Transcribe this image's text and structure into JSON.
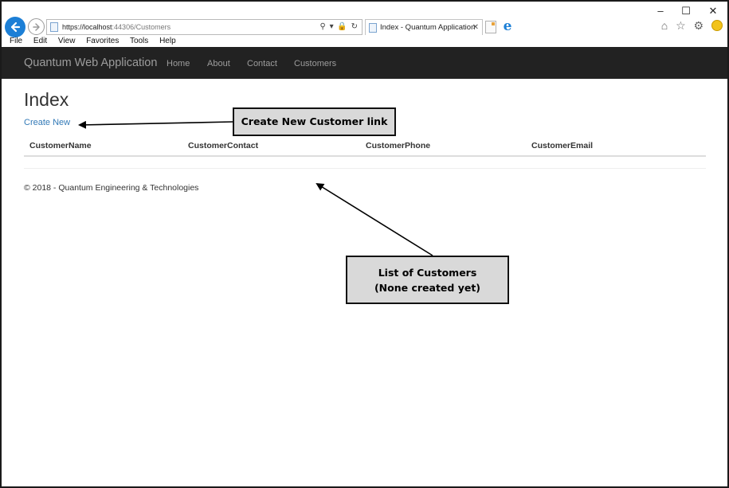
{
  "browser": {
    "url_host": "https://localhost",
    "url_rest": ":44306/Customers",
    "address_tools": "⚲ ▾ 🔒 ↻",
    "tab_title": "Index - Quantum Application",
    "tab_close": "✕",
    "window_controls": {
      "minimize": "–",
      "maximize": "☐",
      "close": "✕"
    },
    "right_icons": "⌂ ☆ ⚙",
    "menu": [
      "File",
      "Edit",
      "View",
      "Favorites",
      "Tools",
      "Help"
    ]
  },
  "navbar": {
    "brand": "Quantum Web Application",
    "links": [
      "Home",
      "About",
      "Contact",
      "Customers"
    ]
  },
  "main": {
    "heading": "Index",
    "create_link": "Create New",
    "table_headers": [
      "CustomerName",
      "CustomerContact",
      "CustomerPhone",
      "CustomerEmail"
    ]
  },
  "footer": {
    "text": "© 2018 - Quantum Engineering & Technologies"
  },
  "annotations": {
    "create_callout": "Create New Customer link",
    "list_callout_line1": "List of Customers",
    "list_callout_line2": "(None created yet)"
  },
  "colors": {
    "navbar": "#222222",
    "link": "#337ab7",
    "callout_fill": "#d9d9d9",
    "browser_accent": "#1c7fd6"
  }
}
